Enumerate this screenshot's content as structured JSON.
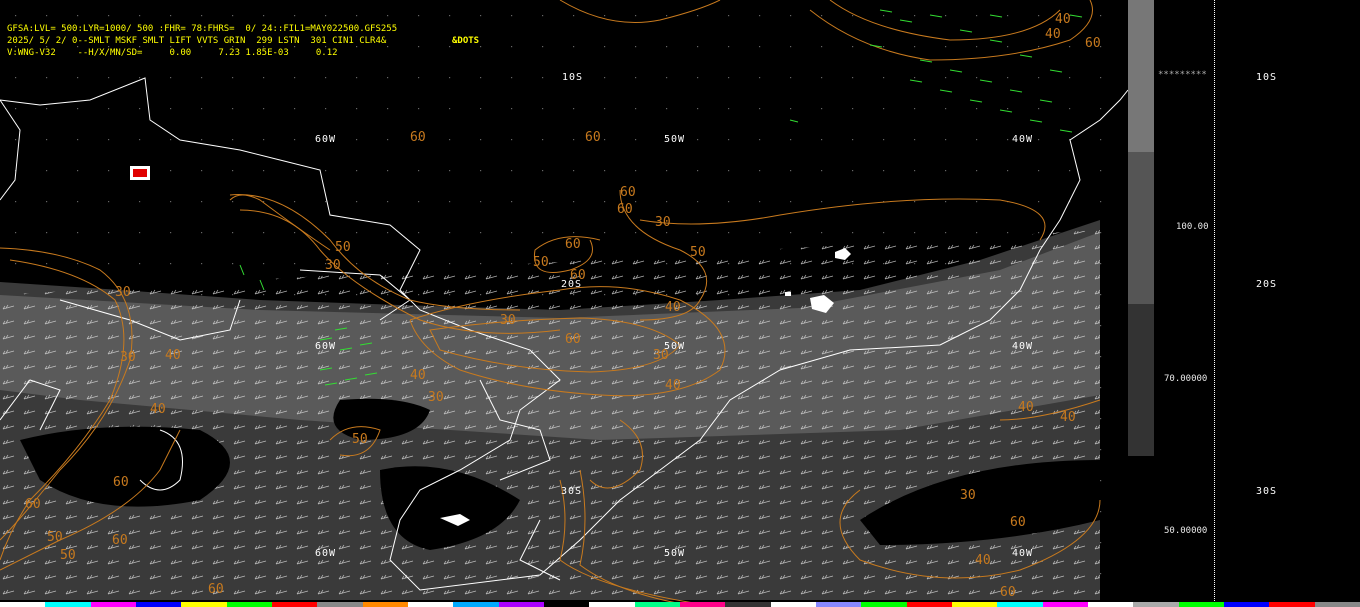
{
  "header": {
    "line1": "GFSA:LVL= 500:LYR=1000/ 500 :FHR= 78:FHRS=  0/ 24::FIL1=MAY022500.GFS255",
    "line2": "2025/ 5/ 2/ 0--SMLT MSKF SMLT LIFT VVTS GRIN  299 LSTN  301 CIN1 CLR4&",
    "line2_extra": "&DOTS",
    "line3": "V:WNG-V32    --H/X/MN/SD=     0.00     7.23 1.85E-03     0.12"
  },
  "map_labels": {
    "lat_10s": "10S",
    "lat_20s": "20S",
    "lat_30s": "30S",
    "lon_60w": "60W",
    "lon_50w": "50W",
    "lon_40w": "40W"
  },
  "contour_labels": [
    "60",
    "60",
    "50",
    "60",
    "60",
    "30",
    "50",
    "60",
    "50",
    "40",
    "40",
    "60",
    "30",
    "30",
    "60",
    "40",
    "30",
    "50",
    "30",
    "40",
    "40",
    "30",
    "40",
    "40",
    "30",
    "60",
    "60",
    "50",
    "50",
    "60",
    "30",
    "60",
    "40",
    "40",
    "60",
    "40",
    "60",
    "60"
  ],
  "scale": {
    "v100": "100.00",
    "v70": "70.00000",
    "v50": "50.00000",
    "asterisks": "*********"
  },
  "right_labels": {
    "lat_10s": "10S",
    "lat_20s": "20S",
    "lat_30s": "30S"
  },
  "colors": {
    "contour": "#c87a1e",
    "wind_barb_green": "#33dd33",
    "coast": "#ffffff",
    "shade_dark": "#333333",
    "shade_mid": "#555555",
    "shade_light": "#777777",
    "header_text": "#ffff00"
  },
  "strip_colors": [
    "#ffffff",
    "#00ffff",
    "#ff00ff",
    "#0000ff",
    "#ffff00",
    "#00ff00",
    "#ff0000",
    "#888888",
    "#ff8800",
    "#ffffff",
    "#00aaff",
    "#aa00ff",
    "#000000",
    "#ffffff",
    "#00ff88",
    "#ff0088",
    "#333333",
    "#ffffff",
    "#8888ff",
    "#00ff00",
    "#ff0000",
    "#ffff00",
    "#00ffff",
    "#ff00ff",
    "#ffffff",
    "#aaaaaa",
    "#00ff00",
    "#0000ff",
    "#ff0000",
    "#888888"
  ]
}
